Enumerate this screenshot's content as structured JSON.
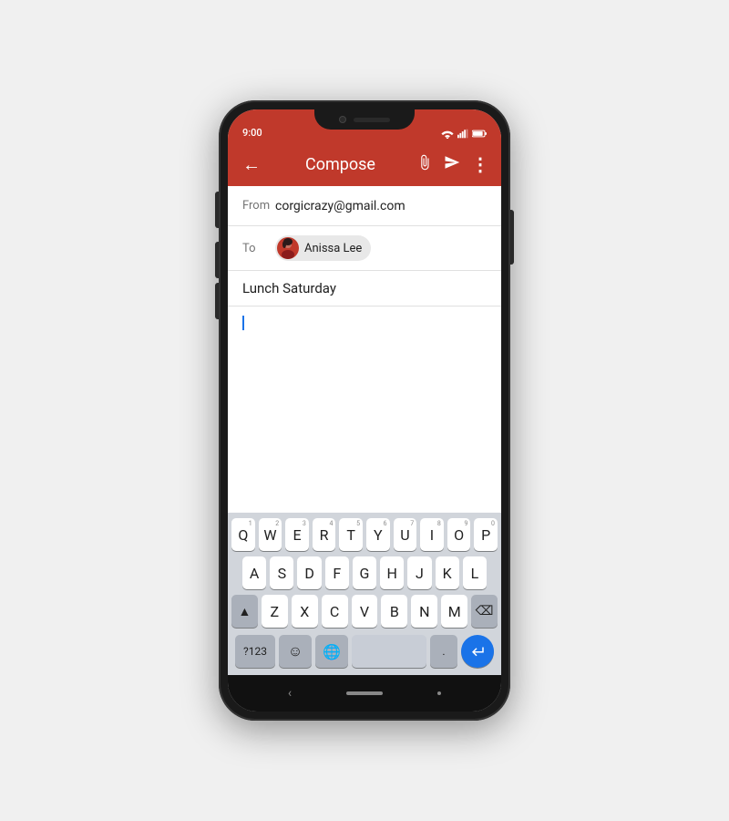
{
  "status": {
    "time": "9:00"
  },
  "app_bar": {
    "title": "Compose",
    "back_label": "←"
  },
  "compose": {
    "from_label": "From",
    "from_value": "corgicrazy@gmail.com",
    "to_label": "To",
    "recipient": "Anissa Lee",
    "subject": "Lunch Saturday"
  },
  "keyboard": {
    "row1": [
      {
        "letter": "Q",
        "num": "1"
      },
      {
        "letter": "W",
        "num": "2"
      },
      {
        "letter": "E",
        "num": "3"
      },
      {
        "letter": "R",
        "num": "4"
      },
      {
        "letter": "T",
        "num": "5"
      },
      {
        "letter": "Y",
        "num": "6"
      },
      {
        "letter": "U",
        "num": "7"
      },
      {
        "letter": "I",
        "num": "8"
      },
      {
        "letter": "O",
        "num": "9"
      },
      {
        "letter": "P",
        "num": "0"
      }
    ],
    "row2": [
      "A",
      "S",
      "D",
      "F",
      "G",
      "H",
      "J",
      "K",
      "L"
    ],
    "row3": [
      "Z",
      "X",
      "C",
      "V",
      "B",
      "N",
      "M"
    ],
    "bottom": {
      "sym_label": "?123",
      "period": ".",
      "enter_icon": "↵"
    }
  }
}
